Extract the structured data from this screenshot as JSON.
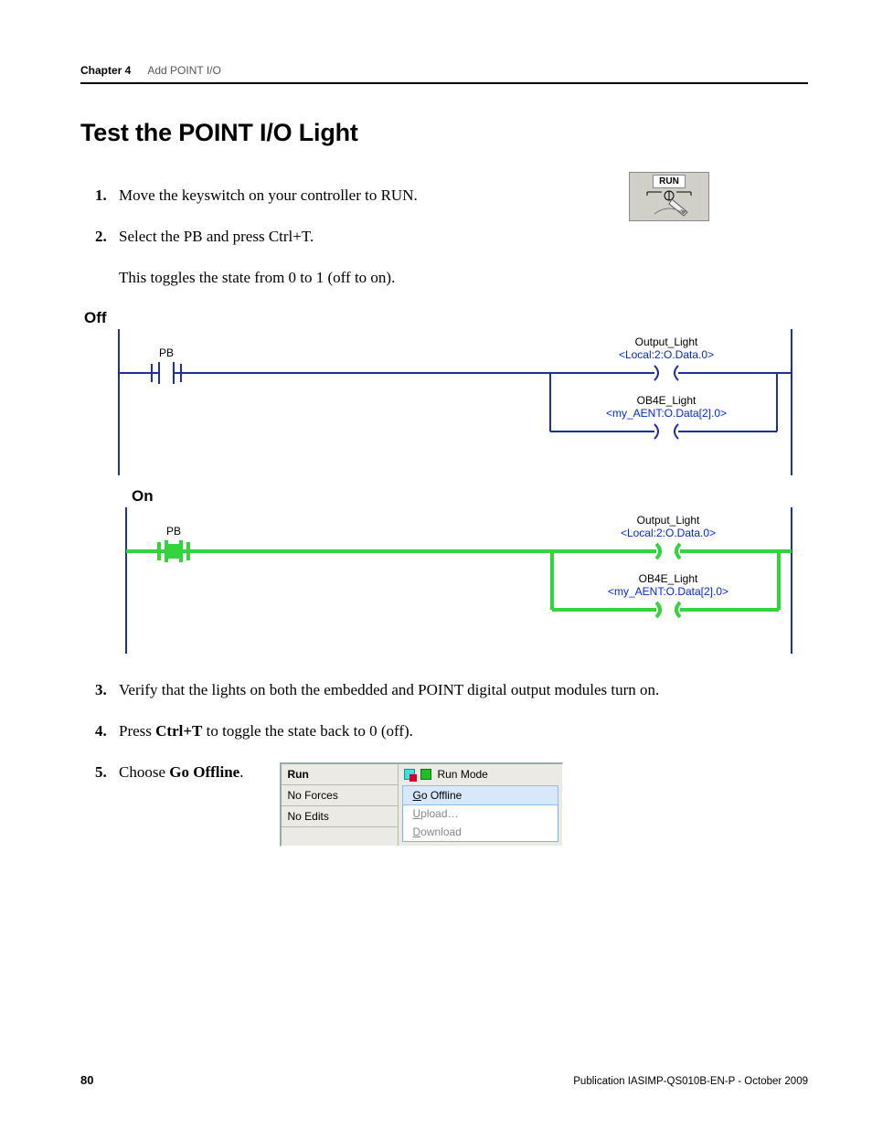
{
  "header": {
    "chapter": "Chapter 4",
    "title": "Add POINT I/O"
  },
  "section_title": "Test the POINT I/O Light",
  "run_icon_label": "RUN",
  "steps": {
    "s1": {
      "num": "1.",
      "text": "Move the keyswitch on your controller to RUN."
    },
    "s2": {
      "num": "2.",
      "text": "Select the PB and press Ctrl+T.",
      "sub": "This toggles the state from 0 to 1 (off to on)."
    },
    "s3": {
      "num": "3.",
      "text": "Verify that the lights on both the embedded and POINT digital output modules turn on."
    },
    "s4": {
      "num": "4.",
      "pre": "Press ",
      "bold": "Ctrl+T",
      "post": " to toggle the state back to 0 (off)."
    },
    "s5": {
      "num": "5.",
      "pre": "Choose ",
      "bold": "Go Offline",
      "post": "."
    }
  },
  "state_labels": {
    "off": "Off",
    "on": "On"
  },
  "ladder": {
    "pb_label": "PB",
    "out1_name": "Output_Light",
    "out1_tag": "<Local:2:O.Data.0>",
    "out2_name": "OB4E_Light",
    "out2_tag": "<my_AENT:O.Data[2].0>"
  },
  "panel": {
    "left": {
      "run": "Run",
      "forces": "No Forces",
      "edits": "No Edits"
    },
    "mode": "Run Mode",
    "menu": {
      "go_offline": "Go Offline",
      "upload": "Upload…",
      "download": "Download"
    }
  },
  "footer": {
    "page": "80",
    "pub": "Publication IASIMP-QS010B-EN-P - October 2009"
  }
}
